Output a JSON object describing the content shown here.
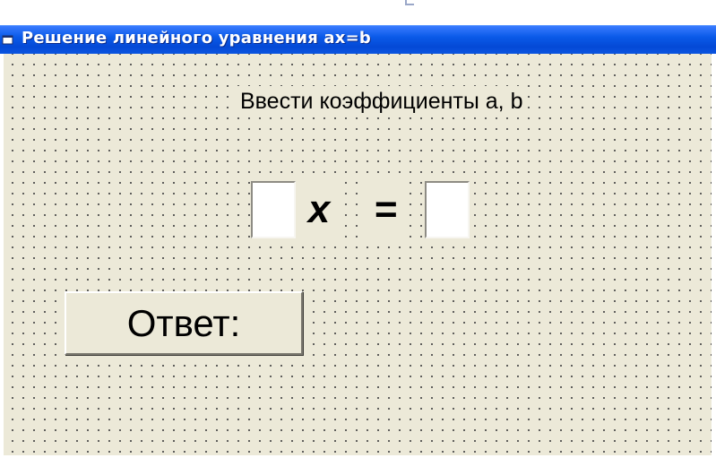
{
  "window": {
    "title": "Решение линейного уравнения ax=b",
    "titlebar_color": "#0a5ae8",
    "icon": "form-app-icon"
  },
  "form": {
    "background_color": "#ece9d8",
    "grid": "dotted",
    "prompt": "Ввести коэффициенты a, b",
    "coefficient_a": {
      "value": "",
      "placeholder": ""
    },
    "variable": "x",
    "equals": "=",
    "coefficient_b": {
      "value": "",
      "placeholder": ""
    },
    "answer_button_label": "Ответ:"
  }
}
